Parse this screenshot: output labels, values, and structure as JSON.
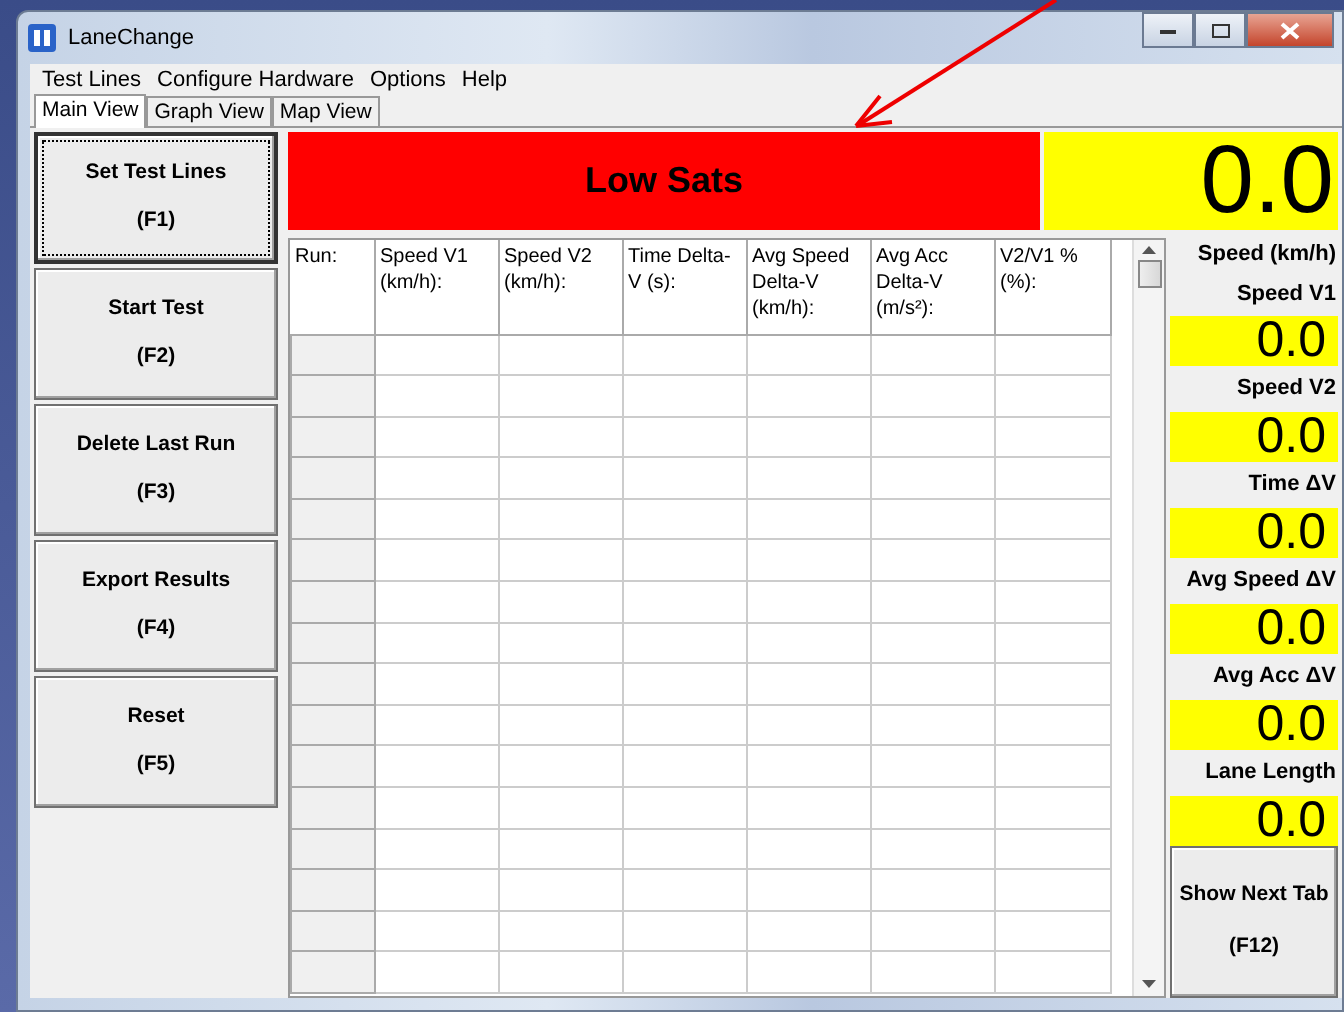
{
  "window": {
    "title": "LaneChange"
  },
  "menu": [
    "Test Lines",
    "Configure Hardware",
    "Options",
    "Help"
  ],
  "tabs": [
    {
      "label": "Main View",
      "selected": true
    },
    {
      "label": "Graph View",
      "selected": false
    },
    {
      "label": "Map View",
      "selected": false
    }
  ],
  "side_buttons": [
    {
      "label": "Set Test Lines",
      "key": "(F1)",
      "focused": true
    },
    {
      "label": "Start Test",
      "key": "(F2)",
      "focused": false
    },
    {
      "label": "Delete Last Run",
      "key": "(F3)",
      "focused": false
    },
    {
      "label": "Export Results",
      "key": "(F4)",
      "focused": false
    },
    {
      "label": "Reset",
      "key": "(F5)",
      "focused": false
    }
  ],
  "status_banner": "Low Sats",
  "speed_display": {
    "value": "0.0",
    "label": "Speed (km/h)"
  },
  "table": {
    "columns": [
      "Run:",
      "Speed V1 (km/h):",
      "Speed V2 (km/h):",
      "Time Delta-V (s):",
      "Avg Speed Delta-V (km/h):",
      "Avg Acc Delta-V (m/s²):",
      "V2/V1 % (%):"
    ]
  },
  "readouts": [
    {
      "label": "Speed V1",
      "value": "0.0"
    },
    {
      "label": "Speed V2",
      "value": "0.0"
    },
    {
      "label": "Time ΔV",
      "value": "0.0"
    },
    {
      "label": "Avg Speed ΔV",
      "value": "0.0"
    },
    {
      "label": "Avg Acc ΔV",
      "value": "0.0"
    },
    {
      "label": "Lane Length",
      "value": "0.0"
    }
  ],
  "next_tab_button": {
    "label": "Show Next Tab",
    "key": "(F12)"
  }
}
